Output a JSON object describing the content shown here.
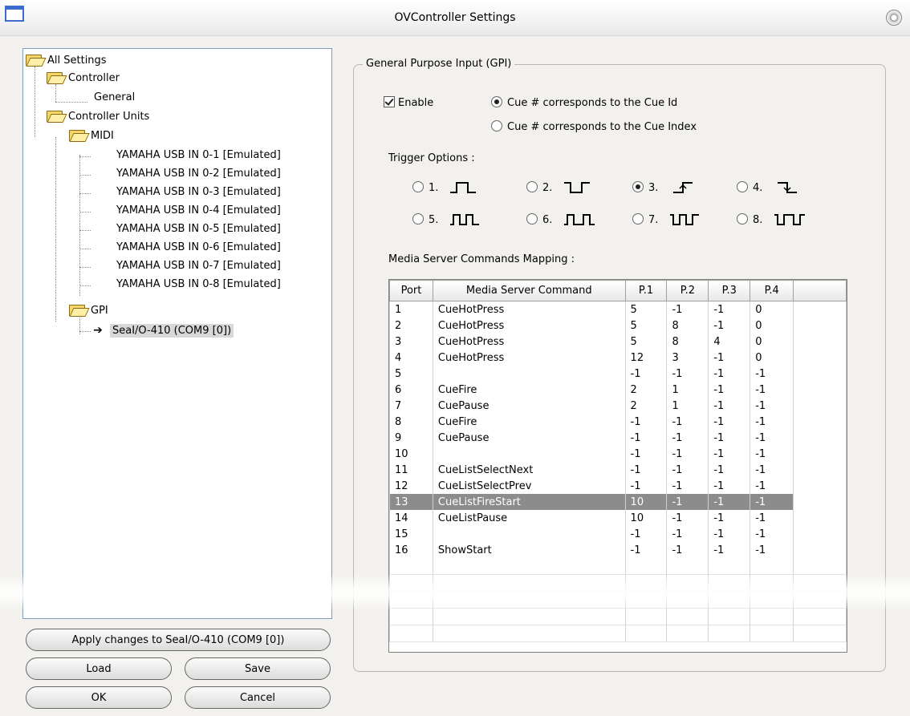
{
  "window": {
    "title": "OVController Settings"
  },
  "tree": {
    "root": "All Settings",
    "controller": "Controller",
    "general": "General",
    "controller_units": "Controller Units",
    "midi": "MIDI",
    "midi_items": [
      "YAMAHA USB IN 0-1 [Emulated]",
      "YAMAHA USB IN 0-2 [Emulated]",
      "YAMAHA USB IN 0-3 [Emulated]",
      "YAMAHA USB IN 0-4 [Emulated]",
      "YAMAHA USB IN 0-5 [Emulated]",
      "YAMAHA USB IN 0-6 [Emulated]",
      "YAMAHA USB IN 0-7 [Emulated]",
      "YAMAHA USB IN 0-8 [Emulated]"
    ],
    "gpi": "GPI",
    "gpi_item": "SeaI/O-410 (COM9 [0])"
  },
  "buttons": {
    "apply": "Apply changes to SeaI/O-410 (COM9 [0])",
    "load": "Load",
    "save": "Save",
    "ok": "OK",
    "cancel": "Cancel"
  },
  "gpi": {
    "group_title": "General Purpose Input (GPI)",
    "enable_label": "Enable",
    "enable_checked": true,
    "cue_id_label": "Cue # corresponds to the Cue Id",
    "cue_index_label": "Cue # corresponds to the Cue Index",
    "selected_cue_mode": "cue_id",
    "trigger_label": "Trigger Options :",
    "trigger_options": [
      "1.",
      "2.",
      "3.",
      "4.",
      "5.",
      "6.",
      "7.",
      "8."
    ],
    "selected_trigger": "3.",
    "mapping_label": "Media Server Commands Mapping :"
  },
  "table": {
    "headers": [
      "Port",
      "Media Server Command",
      "P.1",
      "P.2",
      "P.3",
      "P.4"
    ],
    "rows": [
      [
        "1",
        "CueHotPress",
        "5",
        "-1",
        "-1",
        "0"
      ],
      [
        "2",
        "CueHotPress",
        "5",
        "8",
        "-1",
        "0"
      ],
      [
        "3",
        "CueHotPress",
        "5",
        "8",
        "4",
        "0"
      ],
      [
        "4",
        "CueHotPress",
        "12",
        "3",
        "-1",
        "0"
      ],
      [
        "5",
        "",
        "-1",
        "-1",
        "-1",
        "-1"
      ],
      [
        "6",
        "CueFire",
        "2",
        "1",
        "-1",
        "-1"
      ],
      [
        "7",
        "CuePause",
        "2",
        "1",
        "-1",
        "-1"
      ],
      [
        "8",
        "CueFire",
        "-1",
        "-1",
        "-1",
        "-1"
      ],
      [
        "9",
        "CuePause",
        "-1",
        "-1",
        "-1",
        "-1"
      ],
      [
        "10",
        "",
        "-1",
        "-1",
        "-1",
        "-1"
      ],
      [
        "11",
        "CueListSelectNext",
        "-1",
        "-1",
        "-1",
        "-1"
      ],
      [
        "12",
        "CueListSelectPrev",
        "-1",
        "-1",
        "-1",
        "-1"
      ],
      [
        "13",
        "CueListFireStart",
        "10",
        "-1",
        "-1",
        "-1"
      ],
      [
        "14",
        "CueListPause",
        "10",
        "-1",
        "-1",
        "-1"
      ],
      [
        "15",
        "",
        "-1",
        "-1",
        "-1",
        "-1"
      ],
      [
        "16",
        "ShowStart",
        "-1",
        "-1",
        "-1",
        "-1"
      ]
    ],
    "selected_row": "13"
  }
}
